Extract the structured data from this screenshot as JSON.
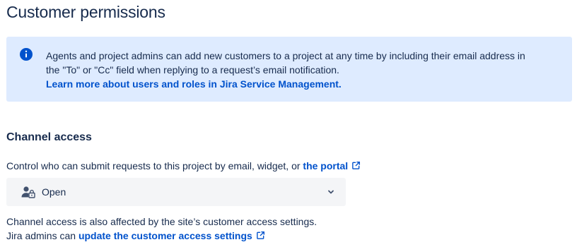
{
  "page": {
    "title": "Customer permissions"
  },
  "info_panel": {
    "icon": "info-icon",
    "line1": "Agents and project admins can add new customers to a project at any time by including their email address in",
    "line2": "the \"To\" or \"Cc\" field when replying to a request’s email notification.",
    "link_label": "Learn more about users and roles in Jira Service Management."
  },
  "channel_access": {
    "heading": "Channel access",
    "description": "Control who can submit requests to this project by email, widget, or ",
    "portal_link": "the portal",
    "select": {
      "icon": "user-lock-icon",
      "value": "Open"
    },
    "footnote_line1": "Channel access is also affected by the site’s customer access settings.",
    "footnote_line2_prefix": "Jira admins can ",
    "settings_link": "update the customer access settings"
  },
  "colors": {
    "text": "#172b4d",
    "link": "#0052cc",
    "info_bg": "#deebff",
    "info_icon": "#0052cc",
    "select_bg": "#f4f5f7"
  }
}
